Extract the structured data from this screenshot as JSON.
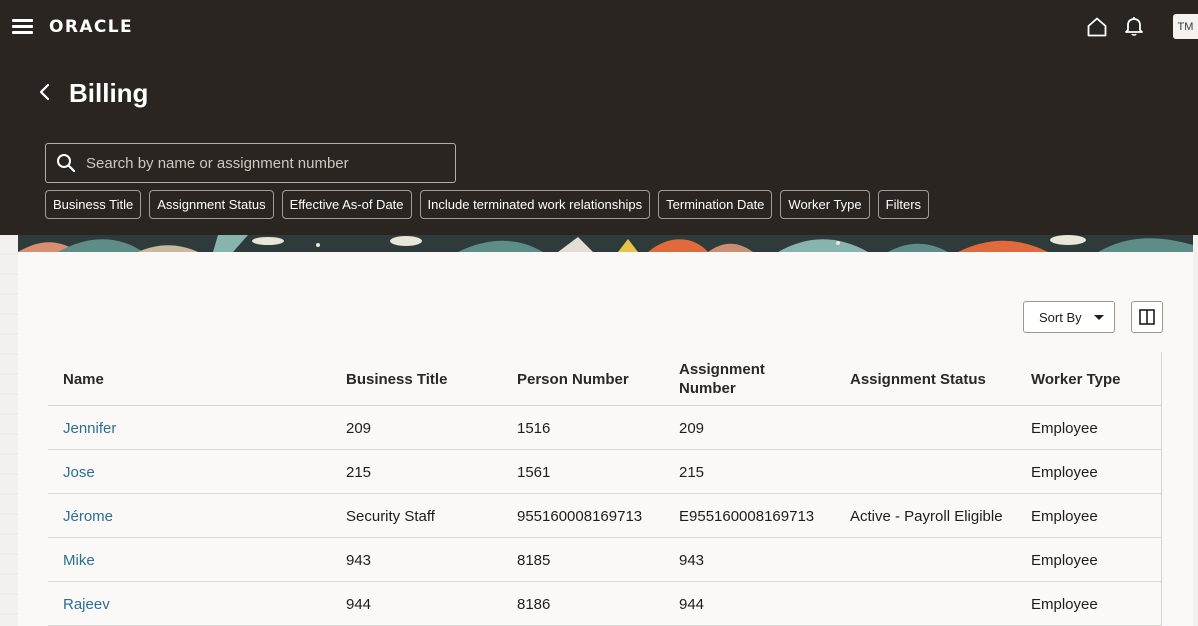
{
  "header": {
    "logo": "ORACLE",
    "avatar_initials": "TM"
  },
  "page": {
    "title": "Billing"
  },
  "search": {
    "placeholder": "Search by name or assignment number",
    "value": ""
  },
  "filter_chips": [
    "Business Title",
    "Assignment Status",
    "Effective As-of Date",
    "Include terminated work relationships",
    "Termination Date",
    "Worker Type",
    "Filters"
  ],
  "toolbar": {
    "sort_label": "Sort By"
  },
  "table": {
    "columns": [
      "Name",
      "Business Title",
      "Person Number",
      "Assignment Number",
      "Assignment Status",
      "Worker Type"
    ],
    "rows": [
      [
        "Jennifer",
        "209",
        "1516",
        "209",
        "",
        "Employee"
      ],
      [
        "Jose",
        "215",
        "1561",
        "215",
        "",
        "Employee"
      ],
      [
        "Jérome",
        "Security Staff",
        "955160008169713",
        "E955160008169713",
        "Active - Payroll Eligible",
        "Employee"
      ],
      [
        "Mike",
        "943",
        "8185",
        "943",
        "",
        "Employee"
      ],
      [
        "Rajeev",
        "944",
        "8186",
        "944",
        "",
        "Employee"
      ]
    ]
  },
  "colors": {
    "header_bg": "#2a2521",
    "content_bg": "#faf9f7",
    "link": "#2c6e91"
  },
  "icons": [
    "menu-icon",
    "home-icon",
    "bell-icon",
    "back-icon",
    "search-icon",
    "caret-down-icon",
    "columns-icon"
  ]
}
